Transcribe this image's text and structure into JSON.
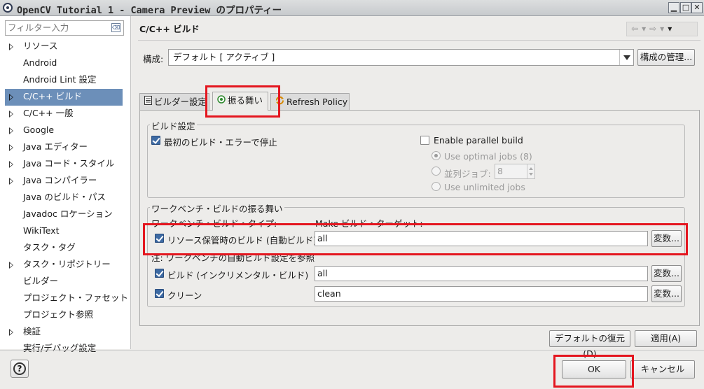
{
  "window": {
    "title": "OpenCV Tutorial 1 - Camera Preview のプロパティー",
    "minimize": "▁",
    "maximize": "□",
    "close": "✕"
  },
  "sidebar": {
    "filter_placeholder": "フィルター入力",
    "items": [
      {
        "label": "リソース",
        "expandable": true
      },
      {
        "label": "Android",
        "expandable": false
      },
      {
        "label": "Android Lint 設定",
        "expandable": false
      },
      {
        "label": "C/C++ ビルド",
        "expandable": true,
        "selected": true
      },
      {
        "label": "C/C++ 一般",
        "expandable": true
      },
      {
        "label": "Google",
        "expandable": true
      },
      {
        "label": "Java エディター",
        "expandable": true
      },
      {
        "label": "Java コード・スタイル",
        "expandable": true
      },
      {
        "label": "Java コンパイラー",
        "expandable": true
      },
      {
        "label": "Java のビルド・パス",
        "expandable": false
      },
      {
        "label": "Javadoc ロケーション",
        "expandable": false
      },
      {
        "label": "WikiText",
        "expandable": false
      },
      {
        "label": "タスク・タグ",
        "expandable": false
      },
      {
        "label": "タスク・リポジトリー",
        "expandable": true
      },
      {
        "label": "ビルダー",
        "expandable": false
      },
      {
        "label": "プロジェクト・ファセット",
        "expandable": false
      },
      {
        "label": "プロジェクト参照",
        "expandable": false
      },
      {
        "label": "検証",
        "expandable": true
      },
      {
        "label": "実行/デバッグ設定",
        "expandable": false
      }
    ]
  },
  "page": {
    "title": "C/C++ ビルド",
    "configuration_label": "構成:",
    "configuration_value": "デフォルト [ アクティブ ]",
    "manage_button": "構成の管理...",
    "tabs": [
      {
        "label": "ビルダー設定",
        "icon": "builder-settings-icon",
        "active": false
      },
      {
        "label": "振る舞い",
        "icon": "behavior-icon",
        "active": true
      },
      {
        "label": "Refresh Policy",
        "icon": "refresh-icon",
        "active": false
      }
    ]
  },
  "build_settings": {
    "group_label": "ビルド設定",
    "stop_on_error": {
      "label": "最初のビルド・エラーで停止",
      "checked": true
    },
    "parallel_build": {
      "label": "Enable parallel build",
      "checked": false
    },
    "optimal_jobs": {
      "label": "Use optimal jobs (8)",
      "selected": true,
      "enabled": false
    },
    "parallel_jobs": {
      "label": "並列ジョブ:",
      "value": "8",
      "selected": false,
      "enabled": false
    },
    "unlimited_jobs": {
      "label": "Use unlimited jobs",
      "selected": false,
      "enabled": false
    }
  },
  "workbench": {
    "group_label": "ワークベンチ・ビルドの振る舞い",
    "col_type": "ワークベンチ・ビルド・タイプ:",
    "col_target": "Make ビルド・ターゲット:",
    "note": "注: ワークベンチの自動ビルド設定を参照",
    "rows": [
      {
        "label": "リソース保管時のビルド (自動ビルド)",
        "checked": true,
        "target": "all",
        "button": "変数..."
      },
      {
        "label": "ビルド (インクリメンタル・ビルド)",
        "checked": true,
        "target": "all",
        "button": "変数..."
      },
      {
        "label": "クリーン",
        "checked": true,
        "target": "clean",
        "button": "変数..."
      }
    ]
  },
  "page_buttons": {
    "restore_defaults": "デフォルトの復元(D)",
    "apply": "適用(A)"
  },
  "dialog_buttons": {
    "ok": "OK",
    "cancel": "キャンセル",
    "help": "?"
  },
  "highlight_color": "#e4161f",
  "accent_color": "#6c8fb9"
}
